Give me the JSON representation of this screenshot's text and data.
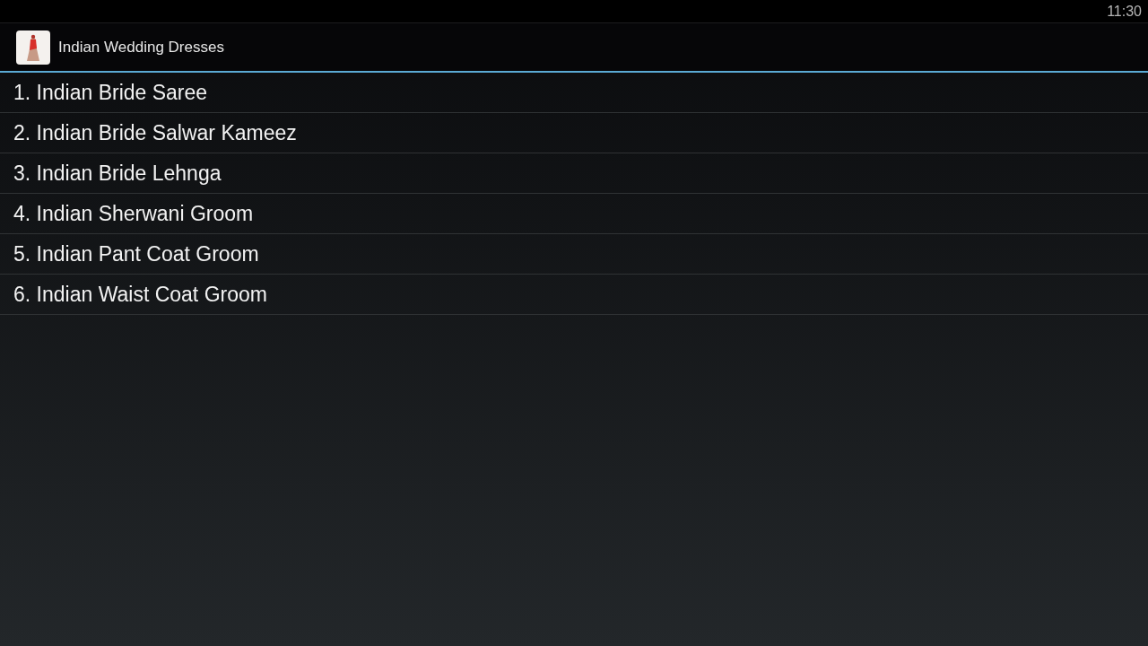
{
  "status_bar": {
    "time": "11:30"
  },
  "action_bar": {
    "title": "Indian Wedding Dresses"
  },
  "list": {
    "items": [
      {
        "label": "1. Indian Bride Saree"
      },
      {
        "label": "2. Indian Bride Salwar Kameez"
      },
      {
        "label": "3. Indian Bride Lehnga"
      },
      {
        "label": "4. Indian Sherwani Groom"
      },
      {
        "label": "5. Indian Pant Coat Groom"
      },
      {
        "label": "6. Indian Waist Coat Groom"
      }
    ]
  }
}
